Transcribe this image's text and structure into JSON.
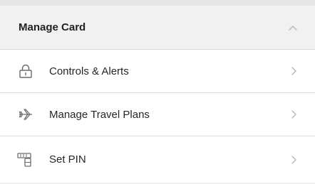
{
  "header": {
    "title": "Manage Card",
    "chevron_icon": "chevron-up-icon"
  },
  "items": [
    {
      "label": "Controls & Alerts",
      "icon": "lock-icon"
    },
    {
      "label": "Manage Travel Plans",
      "icon": "airplane-icon"
    },
    {
      "label": "Set PIN",
      "icon": "keypad-icon"
    }
  ],
  "colors": {
    "header_bg": "#f1f1f1",
    "row_bg": "#ffffff",
    "divider": "#dddddd",
    "text": "#262626",
    "icon": "#6b6b6b",
    "chevron": "#b5b5b5"
  }
}
